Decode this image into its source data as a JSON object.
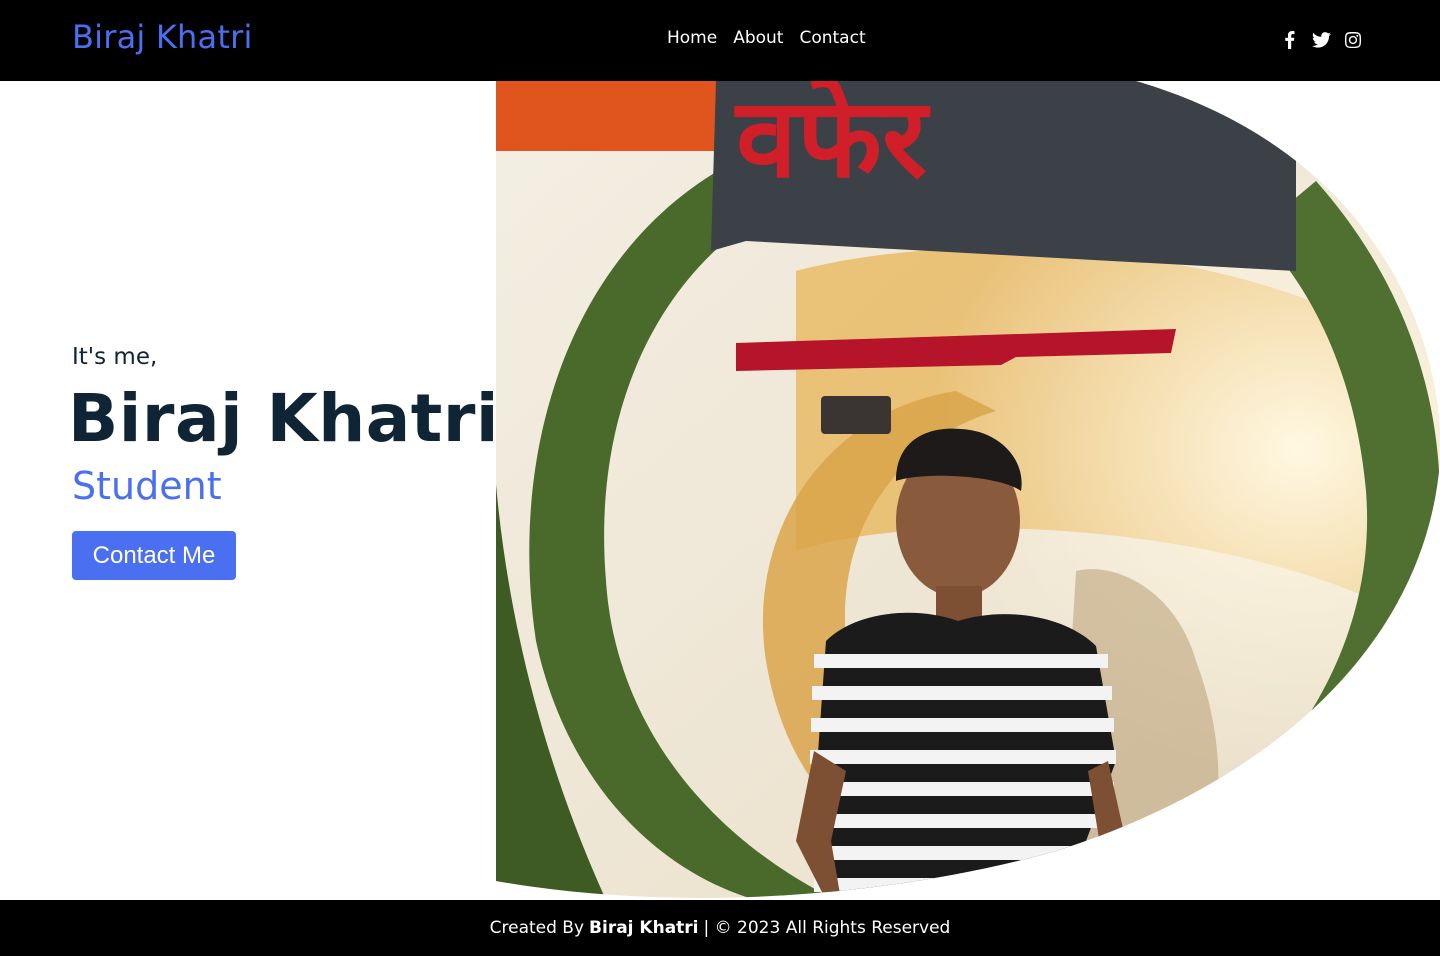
{
  "header": {
    "logo": "Biraj Khatri",
    "nav": [
      {
        "label": "Home"
      },
      {
        "label": "About"
      },
      {
        "label": "Contact"
      }
    ],
    "socials": [
      {
        "icon": "facebook-icon"
      },
      {
        "icon": "twitter-icon"
      },
      {
        "icon": "instagram-icon"
      }
    ]
  },
  "hero": {
    "intro": "It's me,",
    "name": "Biraj Khatri",
    "role": "Student",
    "cta_label": "Contact Me"
  },
  "footer": {
    "prefix": "Created By",
    "author": "Biraj Khatri",
    "suffix": "| © 2023 All Rights Reserved"
  },
  "colors": {
    "accent": "#4a6ff0",
    "header_bg": "#000000",
    "heading": "#0f2434"
  }
}
